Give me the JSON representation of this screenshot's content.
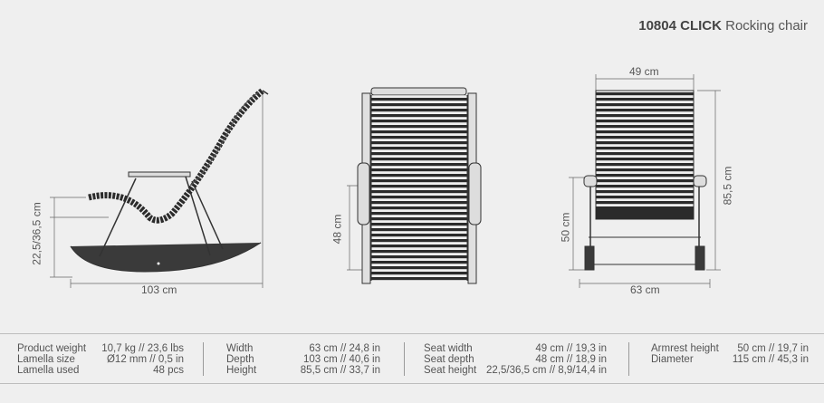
{
  "header": {
    "code": "10804 CLICK",
    "subtitle": "Rocking chair"
  },
  "dimensions": {
    "side_height": "22,5/36,5 cm",
    "side_depth": "103 cm",
    "front_seat_height": "48 cm",
    "back_top_width": "49 cm",
    "back_total_height": "85,5 cm",
    "back_armrest_height": "50 cm",
    "back_width": "63 cm"
  },
  "specs": [
    {
      "rows": [
        {
          "label": "Product weight",
          "value": "10,7 kg // 23,6 lbs"
        },
        {
          "label": "Lamella size",
          "value": "Ø12 mm // 0,5 in"
        },
        {
          "label": "Lamella used",
          "value": "48 pcs"
        }
      ]
    },
    {
      "rows": [
        {
          "label": "Width",
          "value": "63 cm // 24,8 in"
        },
        {
          "label": "Depth",
          "value": "103 cm // 40,6 in"
        },
        {
          "label": "Height",
          "value": "85,5 cm // 33,7 in"
        }
      ]
    },
    {
      "rows": [
        {
          "label": "Seat width",
          "value": "49 cm // 19,3 in"
        },
        {
          "label": "Seat depth",
          "value": "48 cm // 18,9 in"
        },
        {
          "label": "Seat height",
          "value": "22,5/36,5 cm // 8,9/14,4 in"
        }
      ]
    },
    {
      "rows": [
        {
          "label": "Armrest height",
          "value": "50 cm // 19,7 in"
        },
        {
          "label": "Diameter",
          "value": "115 cm // 45,3 in"
        }
      ]
    }
  ]
}
